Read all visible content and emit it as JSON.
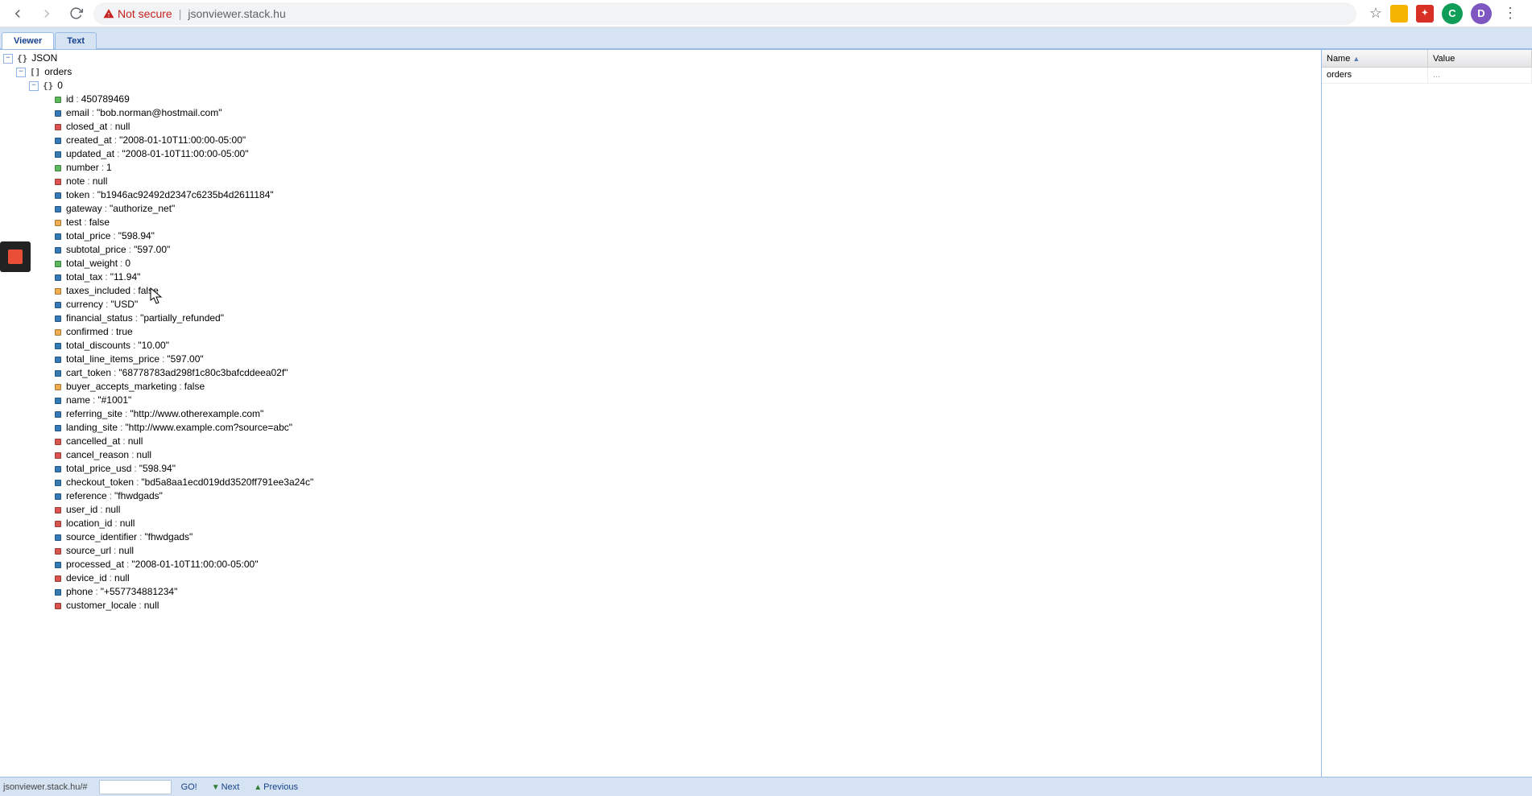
{
  "browser": {
    "not_secure_label": "Not secure",
    "url_host": "jsonviewer.stack.hu",
    "avatar_initial": "D",
    "avatar2_initial": "C"
  },
  "tabs": {
    "viewer": "Viewer",
    "text": "Text"
  },
  "tree": {
    "root_label": "JSON",
    "orders_label": "orders",
    "index_label": "0",
    "props": [
      {
        "key": "id",
        "val": "450789469",
        "c": "b-green"
      },
      {
        "key": "email",
        "val": "\"bob.norman@hostmail.com\"",
        "c": "b-blue"
      },
      {
        "key": "closed_at",
        "val": "null",
        "c": "b-red"
      },
      {
        "key": "created_at",
        "val": "\"2008-01-10T11:00:00-05:00\"",
        "c": "b-blue"
      },
      {
        "key": "updated_at",
        "val": "\"2008-01-10T11:00:00-05:00\"",
        "c": "b-blue"
      },
      {
        "key": "number",
        "val": "1",
        "c": "b-green"
      },
      {
        "key": "note",
        "val": "null",
        "c": "b-red"
      },
      {
        "key": "token",
        "val": "\"b1946ac92492d2347c6235b4d2611184\"",
        "c": "b-blue"
      },
      {
        "key": "gateway",
        "val": "\"authorize_net\"",
        "c": "b-blue"
      },
      {
        "key": "test",
        "val": "false",
        "c": "b-yellow"
      },
      {
        "key": "total_price",
        "val": "\"598.94\"",
        "c": "b-blue"
      },
      {
        "key": "subtotal_price",
        "val": "\"597.00\"",
        "c": "b-blue"
      },
      {
        "key": "total_weight",
        "val": "0",
        "c": "b-green"
      },
      {
        "key": "total_tax",
        "val": "\"11.94\"",
        "c": "b-blue"
      },
      {
        "key": "taxes_included",
        "val": "false",
        "c": "b-yellow"
      },
      {
        "key": "currency",
        "val": "\"USD\"",
        "c": "b-blue"
      },
      {
        "key": "financial_status",
        "val": "\"partially_refunded\"",
        "c": "b-blue"
      },
      {
        "key": "confirmed",
        "val": "true",
        "c": "b-yellow"
      },
      {
        "key": "total_discounts",
        "val": "\"10.00\"",
        "c": "b-blue"
      },
      {
        "key": "total_line_items_price",
        "val": "\"597.00\"",
        "c": "b-blue"
      },
      {
        "key": "cart_token",
        "val": "\"68778783ad298f1c80c3bafcddeea02f\"",
        "c": "b-blue"
      },
      {
        "key": "buyer_accepts_marketing",
        "val": "false",
        "c": "b-yellow"
      },
      {
        "key": "name",
        "val": "\"#1001\"",
        "c": "b-blue"
      },
      {
        "key": "referring_site",
        "val": "\"http://www.otherexample.com\"",
        "c": "b-blue"
      },
      {
        "key": "landing_site",
        "val": "\"http://www.example.com?source=abc\"",
        "c": "b-blue"
      },
      {
        "key": "cancelled_at",
        "val": "null",
        "c": "b-red"
      },
      {
        "key": "cancel_reason",
        "val": "null",
        "c": "b-red"
      },
      {
        "key": "total_price_usd",
        "val": "\"598.94\"",
        "c": "b-blue"
      },
      {
        "key": "checkout_token",
        "val": "\"bd5a8aa1ecd019dd3520ff791ee3a24c\"",
        "c": "b-blue"
      },
      {
        "key": "reference",
        "val": "\"fhwdgads\"",
        "c": "b-blue"
      },
      {
        "key": "user_id",
        "val": "null",
        "c": "b-red"
      },
      {
        "key": "location_id",
        "val": "null",
        "c": "b-red"
      },
      {
        "key": "source_identifier",
        "val": "\"fhwdgads\"",
        "c": "b-blue"
      },
      {
        "key": "source_url",
        "val": "null",
        "c": "b-red"
      },
      {
        "key": "processed_at",
        "val": "\"2008-01-10T11:00:00-05:00\"",
        "c": "b-blue"
      },
      {
        "key": "device_id",
        "val": "null",
        "c": "b-red"
      },
      {
        "key": "phone",
        "val": "\"+557734881234\"",
        "c": "b-blue"
      },
      {
        "key": "customer_locale",
        "val": "null",
        "c": "b-red"
      }
    ]
  },
  "side": {
    "name_header": "Name",
    "value_header": "Value",
    "rows": [
      {
        "name": "orders",
        "value": "..."
      }
    ]
  },
  "status": {
    "text": "jsonviewer.stack.hu/#",
    "go": "GO!",
    "next": "Next",
    "prev": "Previous"
  }
}
